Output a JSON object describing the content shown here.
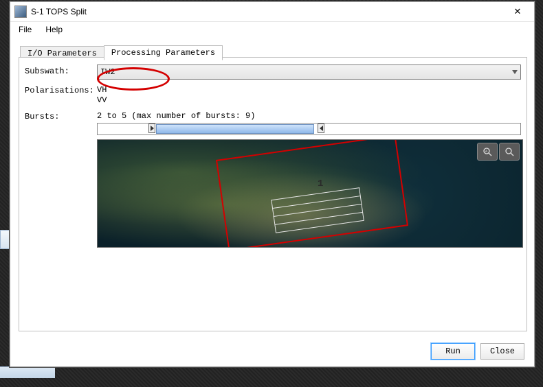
{
  "window": {
    "title": "S-1 TOPS Split"
  },
  "menu": {
    "file": "File",
    "help": "Help"
  },
  "tabs": {
    "io": "I/O Parameters",
    "processing": "Processing Parameters"
  },
  "labels": {
    "subswath": "Subswath:",
    "polarisations": "Polarisations:",
    "bursts": "Bursts:"
  },
  "subswath": {
    "value": "IW2"
  },
  "polarisations": {
    "options": [
      "VH",
      "VV"
    ]
  },
  "bursts": {
    "text": "2 to 5 (max number of bursts: 9)"
  },
  "map": {
    "overlay_number": "1"
  },
  "buttons": {
    "run": "Run",
    "close": "Close"
  }
}
